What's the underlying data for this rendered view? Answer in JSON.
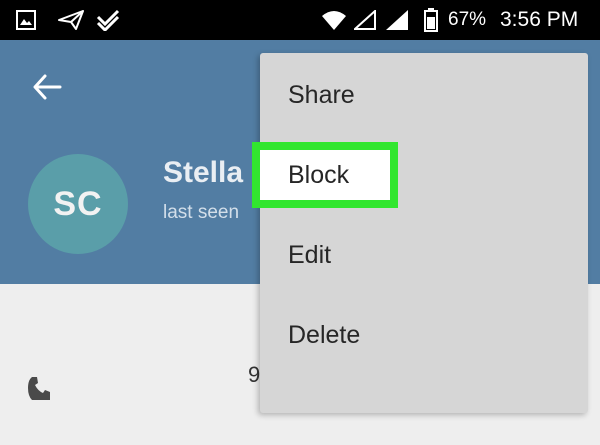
{
  "status_bar": {
    "battery_percent": "67%",
    "time": "3:56 PM",
    "icons": [
      "gallery-icon",
      "send-icon",
      "check-icon",
      "wifi-icon",
      "no-signal-icon",
      "signal-icon",
      "battery-icon"
    ]
  },
  "header": {
    "back_icon": "arrow-left-icon",
    "avatar_initials": "SC",
    "contact_name": "Stella",
    "contact_status": "last seen",
    "colors": {
      "header_bg": "#527da3",
      "avatar_bg": "#5a9ea9"
    }
  },
  "menu": {
    "items": [
      {
        "label": "Share"
      },
      {
        "label": "Block",
        "highlighted": true
      },
      {
        "label": "Edit"
      },
      {
        "label": "Delete"
      }
    ],
    "highlight_color": "#32e62f"
  },
  "content": {
    "phone_icon": "phone-icon",
    "phone_number_partial": "9"
  }
}
